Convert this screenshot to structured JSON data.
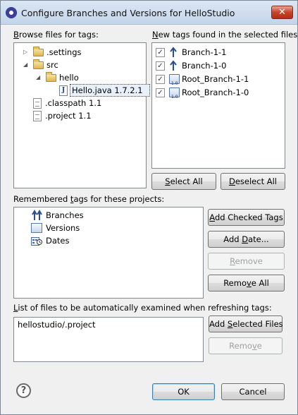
{
  "window": {
    "title": "Configure Branches and Versions for HelloStudio",
    "close_label": "✕"
  },
  "browse": {
    "label_u": "B",
    "label_rest": "rowse files for tags:",
    "tree": [
      {
        "label": ".settings",
        "type": "folder",
        "expander": "▷"
      },
      {
        "label": "src",
        "type": "folder",
        "expander": "◢"
      },
      {
        "label": "hello",
        "type": "folder",
        "expander": "◢"
      },
      {
        "label": "Hello.java 1.7.2.1",
        "type": "java",
        "selected": true
      },
      {
        "label": ".classpath 1.1",
        "type": "file"
      },
      {
        "label": ".project 1.1",
        "type": "file"
      }
    ]
  },
  "newtags": {
    "label_u": "N",
    "label_rest": "ew tags found in the selected files:",
    "items": [
      {
        "label": "Branch-1-1",
        "icon": "branch-icon",
        "checked": true
      },
      {
        "label": "Branch-1-0",
        "icon": "branch-icon",
        "checked": true
      },
      {
        "label": "Root_Branch-1-1",
        "icon": "version-tag-icon",
        "checked": true
      },
      {
        "label": "Root_Branch-1-0",
        "icon": "version-tag-icon",
        "checked": true
      }
    ],
    "select_all_u": "S",
    "select_all_rest": "elect All",
    "deselect_all_u": "D",
    "deselect_all_rest": "eselect All"
  },
  "remembered": {
    "label_pre": "Remembered ",
    "label_u": "t",
    "label_rest": "ags for these projects:",
    "items": [
      {
        "label": "Branches",
        "icon": "branches-icon"
      },
      {
        "label": "Versions",
        "icon": "versions-icon"
      },
      {
        "label": "Dates",
        "icon": "dates-icon"
      }
    ],
    "add_checked_u": "A",
    "add_checked_rest": "dd Checked Tags",
    "add_date_pre": "Add ",
    "add_date_u": "D",
    "add_date_rest": "ate...",
    "remove_u": "R",
    "remove_rest": "emove",
    "remove_all_pre": "Remo",
    "remove_all_u": "v",
    "remove_all_rest": "e All"
  },
  "autofiles": {
    "label_pre": "",
    "label_u": "L",
    "label_rest": "ist of files to be automatically examined when refreshing tags:",
    "items": [
      "hellostudio/.project"
    ],
    "add_selected_pre": "Add ",
    "add_selected_u": "S",
    "add_selected_rest": "elected Files",
    "remove_pre": "Remo",
    "remove_u": "v",
    "remove_rest": "e"
  },
  "footer": {
    "help_label": "?",
    "ok_label": "OK",
    "cancel_label": "Cancel"
  },
  "checkmark": "✓"
}
